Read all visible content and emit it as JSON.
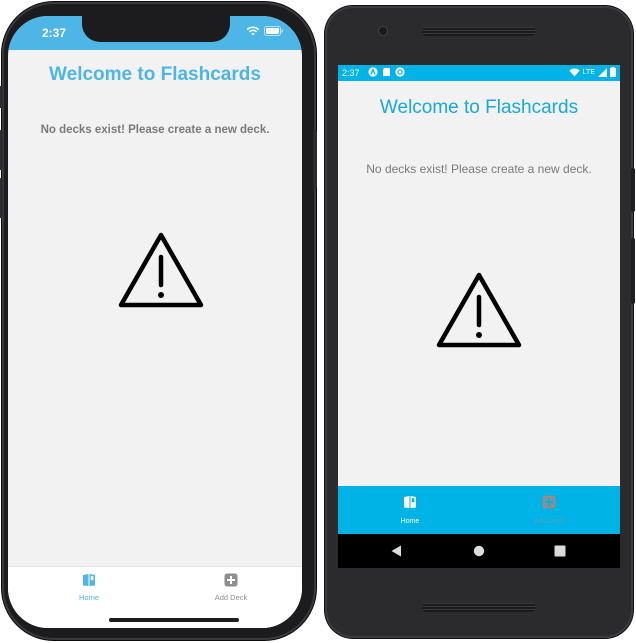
{
  "ios": {
    "status_time": "2:37",
    "title": "Welcome to Flashcards",
    "message": "No decks exist! Please create a new deck.",
    "warning_icon": "warning-triangle-icon",
    "tabs": [
      {
        "label": "Home",
        "icon": "deck-book-icon",
        "active": true
      },
      {
        "label": "Add Deck",
        "icon": "plus-square-icon",
        "active": false
      }
    ]
  },
  "android": {
    "status_time": "2:37",
    "status_network": "LTE",
    "title": "Welcome to Flashcards",
    "message": "No decks exist! Please create a new deck.",
    "warning_icon": "warning-triangle-icon",
    "tabs": [
      {
        "label": "Home",
        "icon": "deck-book-icon",
        "active": true
      },
      {
        "label": "Add Deck",
        "icon": "plus-square-icon",
        "active": false
      }
    ],
    "nav_buttons": [
      "back-icon",
      "home-icon",
      "recents-icon"
    ]
  },
  "colors": {
    "ios_accent": "#4db6e6",
    "android_accent": "#00b3e6",
    "android_title": "#18a8e0",
    "message_text": "#7a7a7a",
    "screen_bg": "#f2f2f2",
    "tab_inactive": "#8e8e8e"
  }
}
